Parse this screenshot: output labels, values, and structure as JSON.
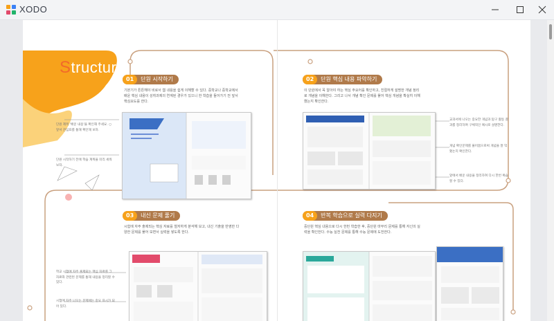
{
  "app": {
    "name": "XODO"
  },
  "window_controls": {
    "minimize": "minimize",
    "maximize": "maximize",
    "close": "close"
  },
  "colors": {
    "accent_orange": "#f7a21b",
    "section_brown": "#b07a4a",
    "title_orange": "#f26a2a"
  },
  "page": {
    "title_first_letter": "S",
    "title_rest": "tructure",
    "sections": [
      {
        "num": "01",
        "title": "단원 시작하기",
        "body": "기본기가 튼튼해야 비로서 웹 내용을 쉽게 이해할 수 있다. 중학교나 중학교에서 배운 핵심 내용이 성취과제의 연계된 경우가 있으니 한 학습을 들어가기 전 앞서 핵심요도를 한다.",
        "notes": [
          "단원 제목 '배운 내용'을 확인해 주세요. ○ 앞서 관심표를 통해 확인해 보자.",
          "단원 시작하기 전에 학습 계획을 미리 세워 보자."
        ]
      },
      {
        "num": "02",
        "title": "단원 핵심 내용 파악하기",
        "body": "이 단원에서 꼭 알아야 하는 핵심 주요어를 확인하고, 친절하게 설명한 개념 정리로 개념을 이해한다. 그리고 나서 개념 확인 문제를 풀어 핵심 개념을 확실히 이해했는지 확인한다.",
        "notes": [
          "교과서에 나오는 중요한 개념과 탐구 활동 결과를 정리하여 구체적인 예시로 설명한다.",
          "개념 확인문제를 풀어봄으로써 개념을 잘 익혔는지 확인한다.",
          "앞에서 배운 내용을 정리하여 다시 한번 복습할 수 있다."
        ]
      },
      {
        "num": "03",
        "title": "내신 문제 풀기",
        "body": "시험에 자주 출제되는 핵심 자료를 철저하게 분석해 보고, 내신 기출을 반영한 다양한 문제를 풀어 보면서 실력을 쌓도록 한다.",
        "notes": [
          "학교 시험에 자주 출제되는 핵심 자료를 그 자료와 관련된 문제를 통해 내용을 정리할 수 있다.",
          "시험에 자주 나오는 문제에는 중요 표시가 되어 있다."
        ]
      },
      {
        "num": "04",
        "title": "반복 학습으로 실력 다지기",
        "body": "중단원 핵심 내용으로 다시 한번 학습한 후, 중단원 마무리 문제를 통해 자신의 실력을 확인한다. 수능 실전 문제를 통해 수능 문제에 도전한다.",
        "notes": []
      }
    ]
  }
}
